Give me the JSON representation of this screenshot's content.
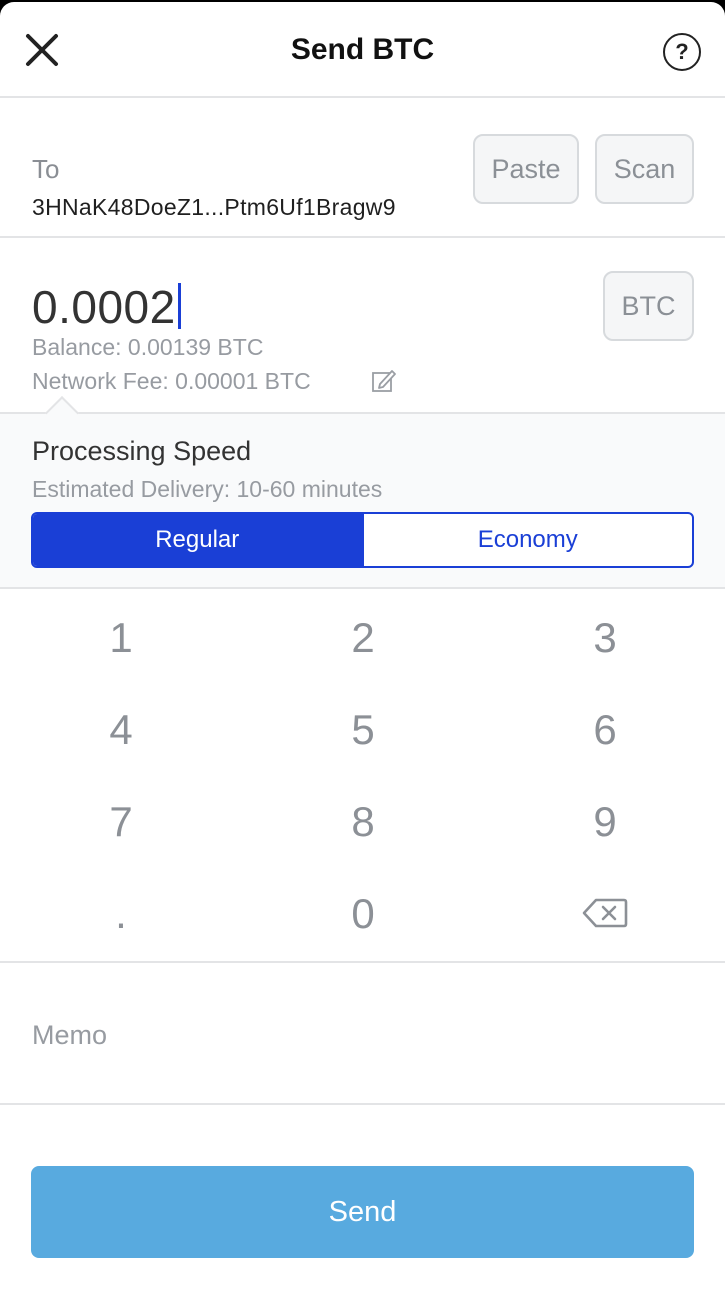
{
  "header": {
    "title": "Send BTC",
    "close_icon": "close-icon",
    "help_label": "?"
  },
  "recipient": {
    "label": "To",
    "address": "3HNaK48DoeZ1...Ptm6Uf1Bragw9",
    "paste_label": "Paste",
    "scan_label": "Scan"
  },
  "amount": {
    "value": "0.0002",
    "currency_label": "BTC",
    "balance_text": "Balance: 0.00139 BTC",
    "fee_text": "Network Fee: 0.00001 BTC",
    "edit_icon": "pencil-icon"
  },
  "speed": {
    "title": "Processing Speed",
    "estimate": "Estimated Delivery: 10-60 minutes",
    "options": [
      "Regular",
      "Economy"
    ],
    "selected": "Regular"
  },
  "keypad": {
    "keys": [
      "1",
      "2",
      "3",
      "4",
      "5",
      "6",
      "7",
      "8",
      "9",
      ".",
      "0"
    ],
    "backspace_icon": "backspace-icon"
  },
  "memo": {
    "placeholder": "Memo"
  },
  "send_label": "Send",
  "colors": {
    "accent": "#1a3fd6",
    "send_button": "#58aadf"
  }
}
